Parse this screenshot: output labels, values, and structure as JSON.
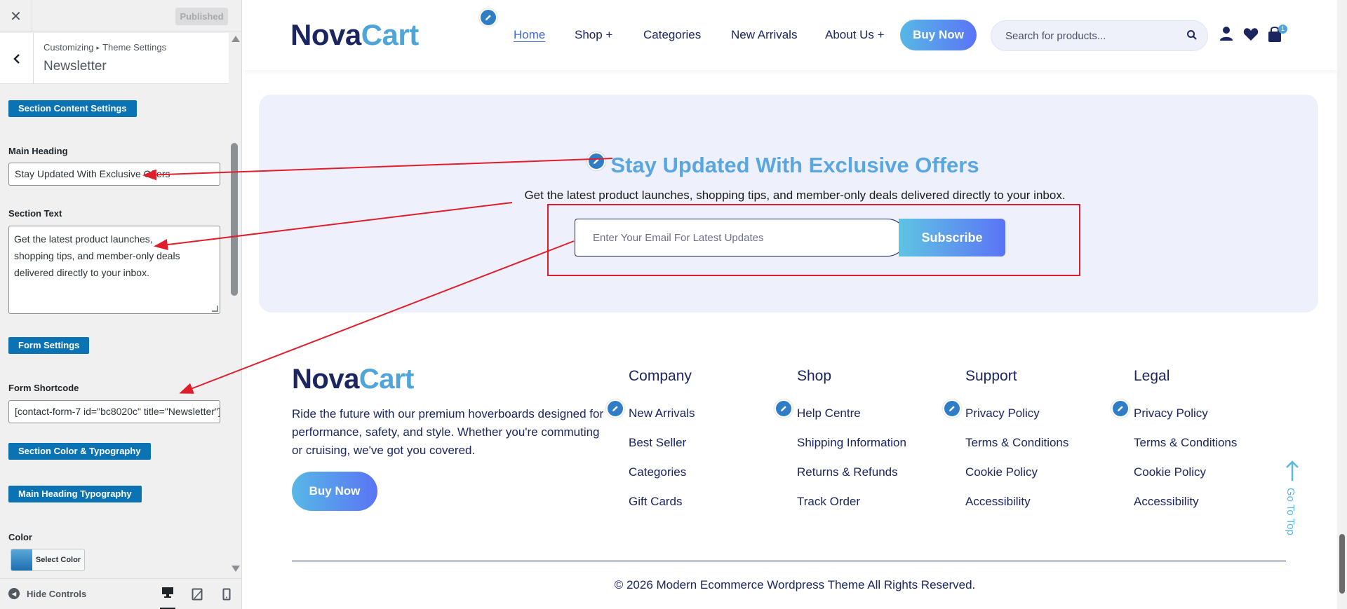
{
  "sidebar": {
    "close_glyph": "✕",
    "published": "Published",
    "back_glyph": "‹",
    "breadcrumb": {
      "parent": "Customizing",
      "separator": "▸",
      "child": "Theme Settings"
    },
    "panel_title": "Newsletter",
    "section_content_btn": "Section Content Settings",
    "main_heading_label": "Main Heading",
    "main_heading_value": "Stay Updated With Exclusive Offers",
    "section_text_label": "Section Text",
    "section_text_lines": [
      "Get the latest product launches,",
      "shopping tips, and member-only deals",
      "delivered directly to your inbox."
    ],
    "form_settings_btn": "Form Settings",
    "form_shortcode_label": "Form Shortcode",
    "form_shortcode_value": "[contact-form-7 id=\"bc8020c\" title=\"Newsletter\"]",
    "color_typography_btn": "Section Color & Typography",
    "heading_typography_btn": "Main Heading Typography",
    "color_label": "Color",
    "select_color": "Select Color",
    "hide_controls": "Hide Controls",
    "device_icons": [
      "desktop-icon",
      "tablet-icon",
      "mobile-icon"
    ]
  },
  "header": {
    "logo_part1": "Nova",
    "logo_part2": "Cart",
    "nav": {
      "home": "Home",
      "shop": "Shop +",
      "categories": "Categories",
      "new_arrivals": "New Arrivals",
      "about": "About Us +"
    },
    "buy_now": "Buy Now",
    "search_placeholder": "Search for products...",
    "cart_count": "1"
  },
  "newsletter": {
    "heading": "Stay Updated With Exclusive Offers",
    "text": "Get the latest product launches, shopping tips, and member-only deals delivered directly to your inbox.",
    "email_placeholder": "Enter Your Email For Latest Updates",
    "subscribe": "Subscribe"
  },
  "footer": {
    "logo_part1": "Nova",
    "logo_part2": "Cart",
    "description": "Ride the future with our premium hoverboards designed for performance, safety, and style. Whether you're commuting or cruising, we've got you covered.",
    "buy_now": "Buy Now",
    "columns": [
      {
        "title": "Company",
        "links": [
          "New Arrivals",
          "Best Seller",
          "Categories",
          "Gift Cards"
        ]
      },
      {
        "title": "Shop",
        "links": [
          "Help Centre",
          "Shipping Information",
          "Returns & Refunds",
          "Track Order"
        ]
      },
      {
        "title": "Support",
        "links": [
          "Privacy Policy",
          "Terms & Conditions",
          "Cookie Policy",
          "Accessibility"
        ]
      },
      {
        "title": "Legal",
        "links": [
          "Privacy Policy",
          "Terms & Conditions",
          "Cookie Policy",
          "Accessibility"
        ]
      }
    ],
    "go_to_top": "Go To Top",
    "copyright": "© 2026 Modern Ecommerce Wordpress Theme All Rights Reserved."
  },
  "colors": {
    "customizer_button": "#0b73b3",
    "brand_navy": "#1b2560",
    "brand_light_blue": "#4fa5d8",
    "nav_active": "#4169e1",
    "annotation_red": "#e01e2b",
    "newsletter_bg": "#eef0fb"
  }
}
